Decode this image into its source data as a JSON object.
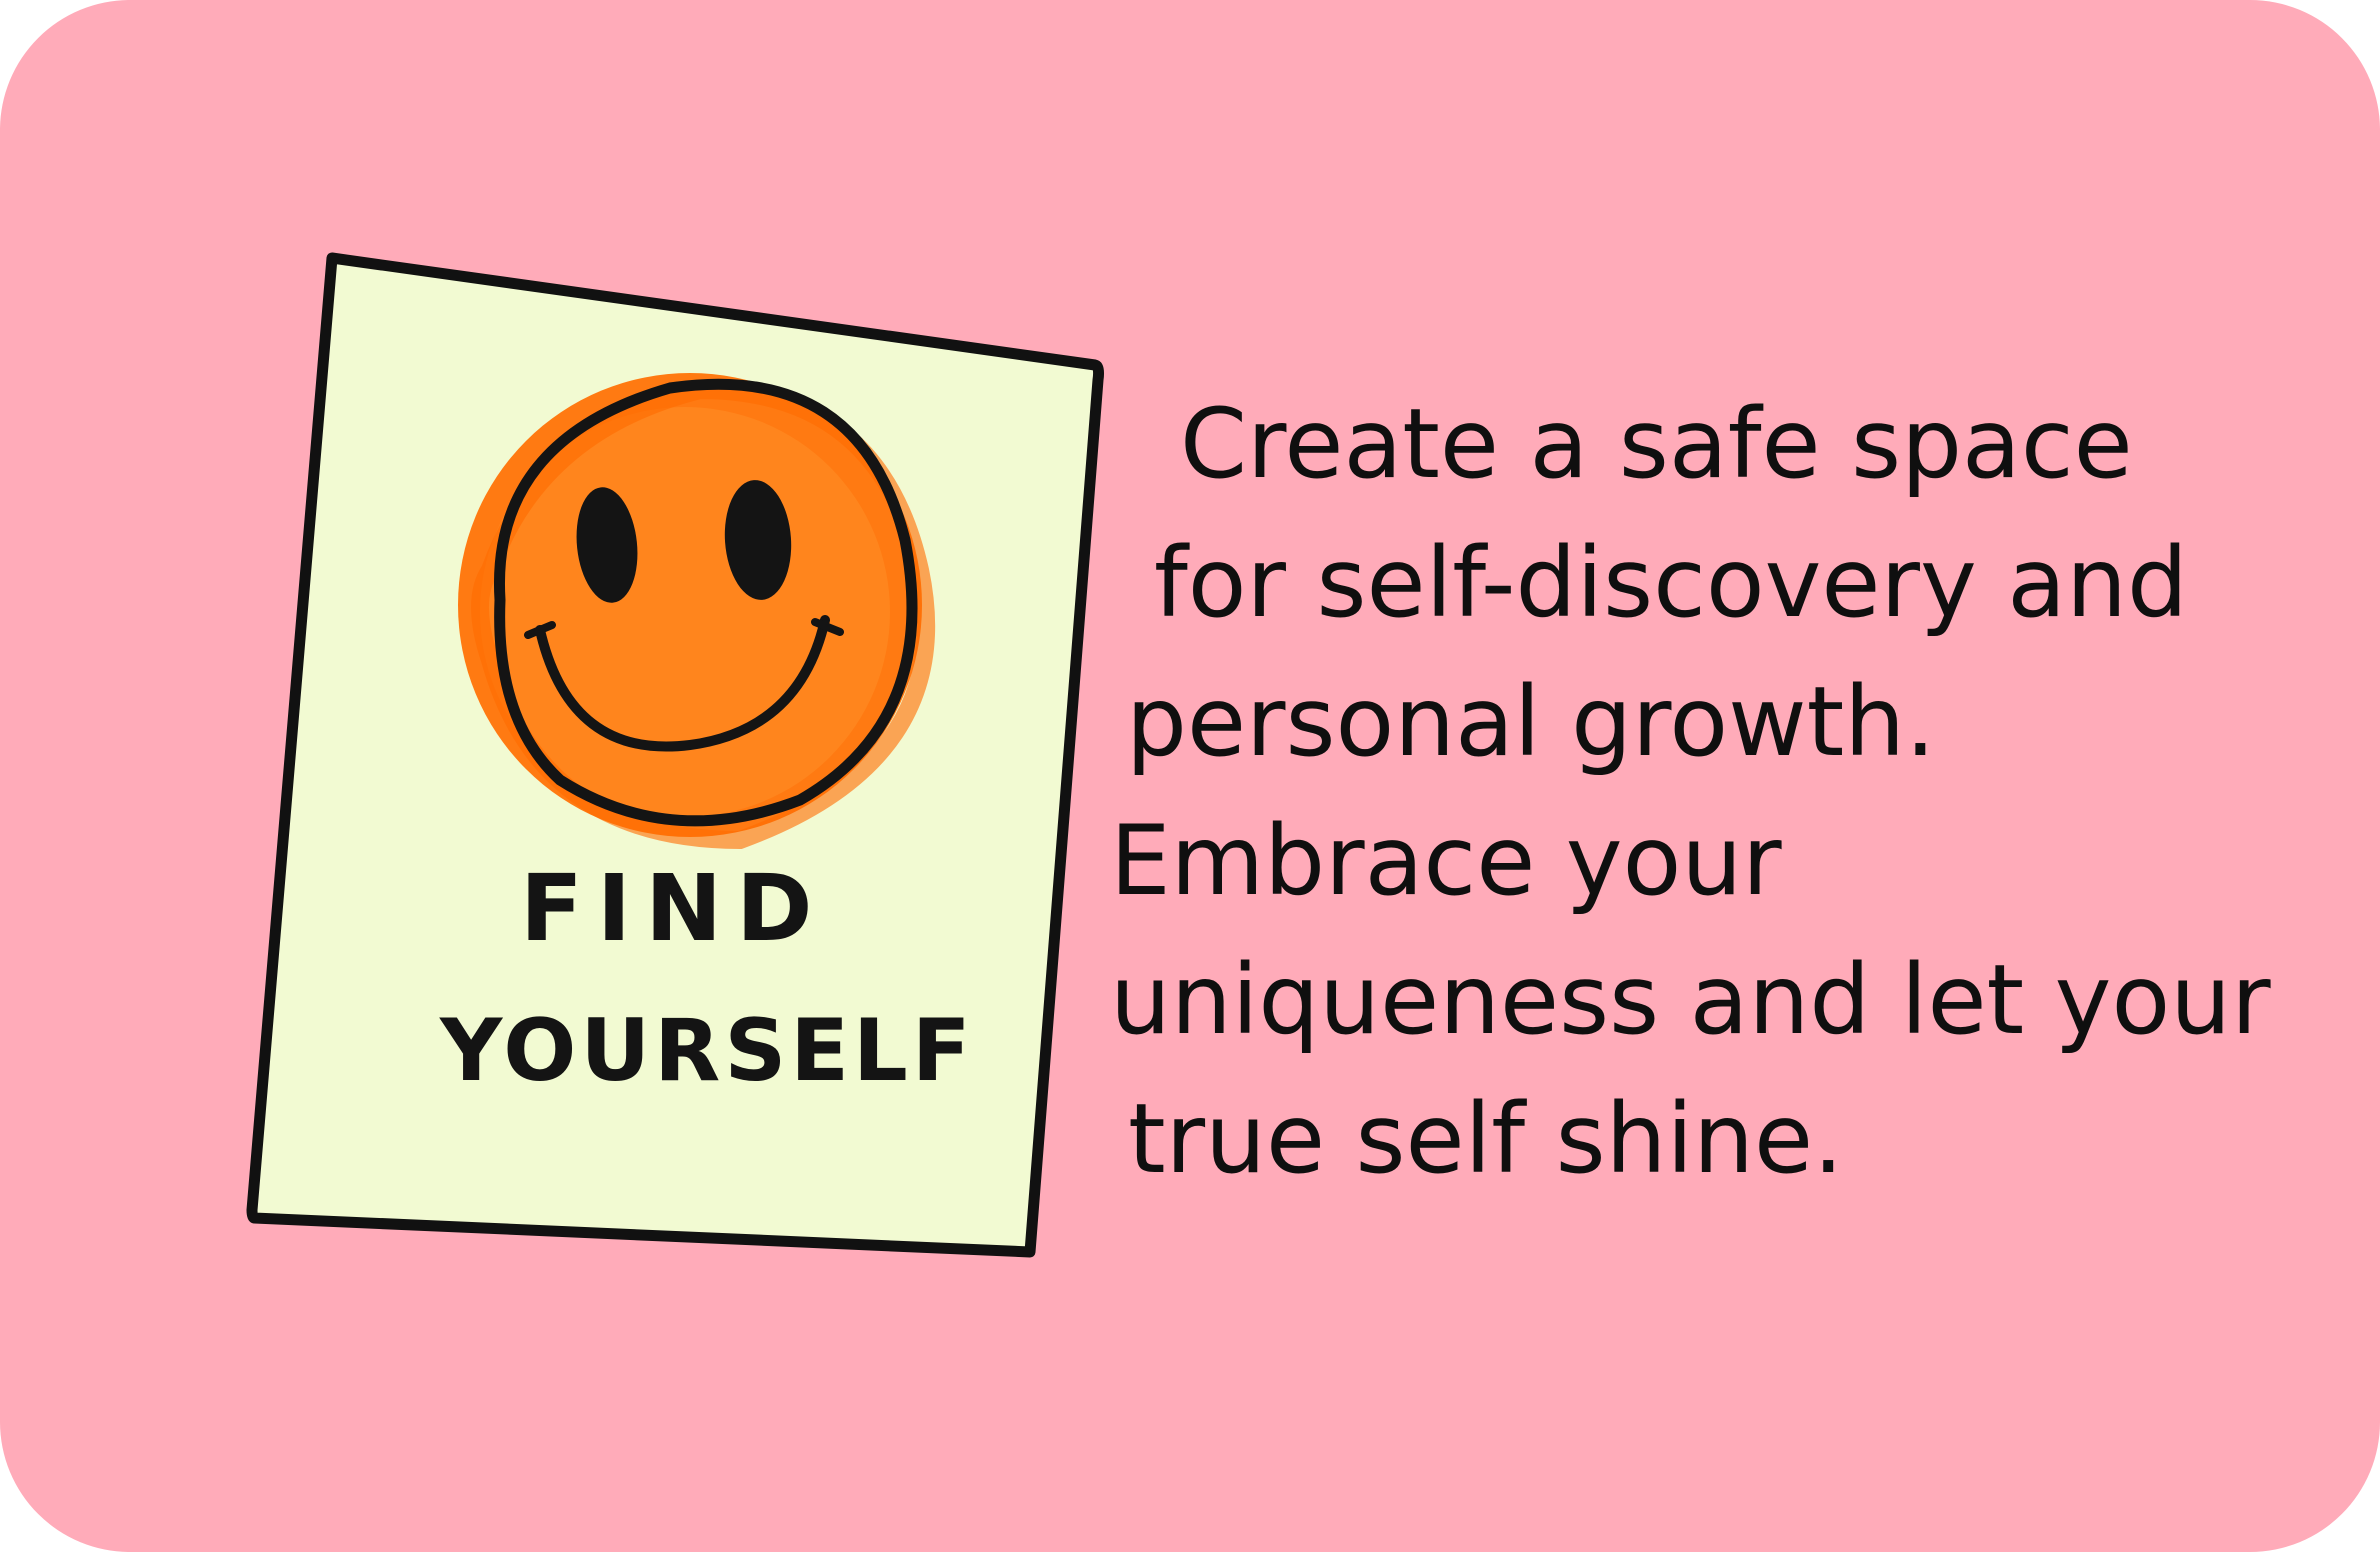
{
  "sticker": {
    "line1": "FIND",
    "line2": "YOURSELF",
    "icon": "smiley-face-icon"
  },
  "message": {
    "lines": [
      "Create a safe space",
      "for self-discovery and",
      "personal growth.",
      "Embrace your",
      "uniqueness and let your",
      "true self shine."
    ]
  },
  "colors": {
    "background": "#ffabb9",
    "sticker_paper": "#f2fad2",
    "smiley": "#ff7a12",
    "ink": "#141414"
  }
}
